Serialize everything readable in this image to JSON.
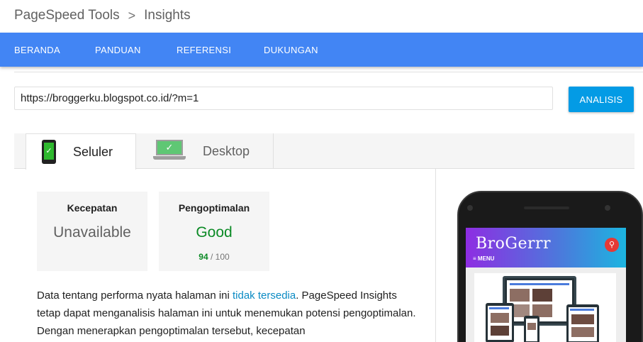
{
  "breadcrumb": {
    "root": "PageSpeed Tools",
    "separator": ">",
    "current": "Insights"
  },
  "nav": {
    "items": [
      "BERANDA",
      "PANDUAN",
      "REFERENSI",
      "DUKUNGAN"
    ]
  },
  "url_input": {
    "value": "https://broggerku.blogspot.co.id/?m=1"
  },
  "analyze_button": {
    "label": "ANALISIS"
  },
  "tabs": [
    {
      "label": "Seluler",
      "icon": "mobile-phone-check-icon",
      "active": true
    },
    {
      "label": "Desktop",
      "icon": "desktop-monitor-check-icon",
      "active": false
    }
  ],
  "speed_card": {
    "title": "Kecepatan",
    "value": "Unavailable"
  },
  "optimization_card": {
    "title": "Pengoptimalan",
    "value": "Good",
    "score": "94",
    "score_max": "/ 100"
  },
  "description": {
    "before_link": "Data tentang performa nyata halaman ini ",
    "link": "tidak tersedia",
    "after_link": ". PageSpeed Insights tetap dapat menganalisis halaman ini untuk menemukan potensi pengoptimalan. Dengan menerapkan pengoptimalan tersebut, kecepatan"
  },
  "preview": {
    "site_logo": "BroGerrr",
    "site_menu": "≡ MENU",
    "search_icon": "search-icon"
  },
  "colors": {
    "nav_bg": "#4285f4",
    "button_bg": "#039be5",
    "good": "#0b8a25",
    "link": "#0b8bc4"
  }
}
